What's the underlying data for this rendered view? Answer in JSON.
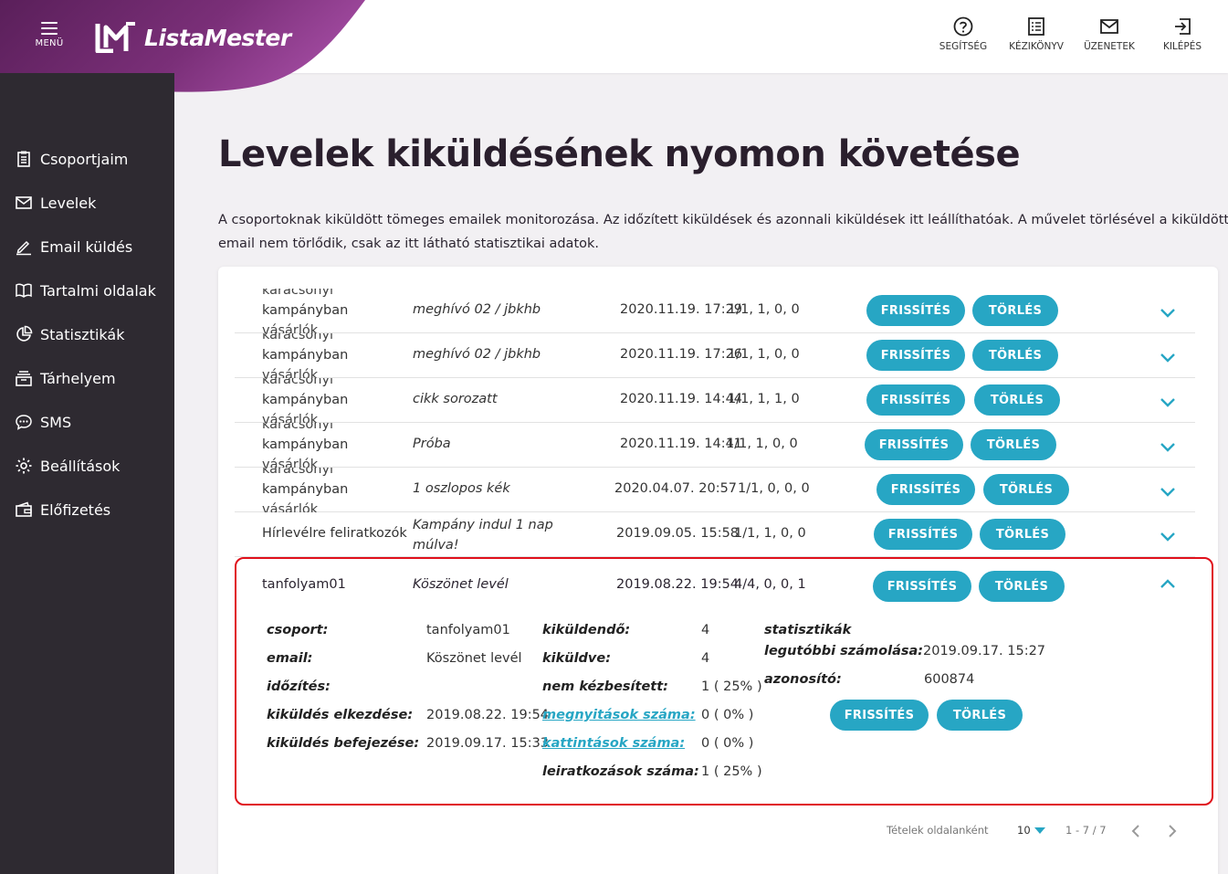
{
  "header": {
    "menu_label": "MENÜ",
    "logo_text": "ListaMester",
    "actions": [
      {
        "label": "SEGÍTSÉG",
        "icon": "help-icon"
      },
      {
        "label": "KÉZIKÖNYV",
        "icon": "manual-icon"
      },
      {
        "label": "ÜZENETEK",
        "icon": "mail-icon"
      },
      {
        "label": "KILÉPÉS",
        "icon": "logout-icon"
      }
    ]
  },
  "sidebar": {
    "items": [
      {
        "label": "Csoportjaim",
        "icon": "clipboard-icon"
      },
      {
        "label": "Levelek",
        "icon": "envelope-icon"
      },
      {
        "label": "Email küldés",
        "icon": "pen-icon"
      },
      {
        "label": "Tartalmi oldalak",
        "icon": "book-icon"
      },
      {
        "label": "Statisztikák",
        "icon": "pie-chart-icon"
      },
      {
        "label": "Tárhelyem",
        "icon": "storage-icon"
      },
      {
        "label": "SMS",
        "icon": "sms-icon"
      },
      {
        "label": "Beállítások",
        "icon": "gear-icon"
      },
      {
        "label": "Előfizetés",
        "icon": "wallet-icon"
      }
    ]
  },
  "page": {
    "title": "Levelek kiküldésének nyomon követése",
    "description": "A csoportoknak kiküldött tömeges emailek monitorozása. Az időzített kiküldések és azonnali kiküldések itt leállíthatóak. A művelet törlésével a kiküldött email nem törlődik, csak az itt látható statisztikai adatok."
  },
  "buttons": {
    "refresh": "FRISSÍTÉS",
    "delete": "TÖRLÉS"
  },
  "rows": [
    {
      "group_top": "karácsonyi",
      "group_mid": "kampányban",
      "group_bot": "vásárlók",
      "email": "meghívó 02 / jbkhb",
      "date": "2020.11.19. 17:29",
      "stats": "1/1, 1, 0, 0"
    },
    {
      "group_top": "karácsonyi",
      "group_mid": "kampányban",
      "group_bot": "vásárlók",
      "email": "meghívó 02 / jbkhb",
      "date": "2020.11.19. 17:26",
      "stats": "1/1, 1, 0, 0"
    },
    {
      "group_top": "karácsonyi",
      "group_mid": "kampányban",
      "group_bot": "vásárlók",
      "email": "cikk sorozatt",
      "date": "2020.11.19. 14:44",
      "stats": "1/1, 1, 1, 0"
    },
    {
      "group_top": "karácsonyi",
      "group_mid": "kampányban",
      "group_bot": "vásárlók",
      "email": "Próba",
      "date": "2020.11.19. 14:41",
      "stats": "1/1, 1, 0, 0"
    },
    {
      "group_top": "karácsonyi",
      "group_mid": "kampányban",
      "group_bot": "vásárlók",
      "email": "1 oszlopos kék",
      "date": "2020.04.07. 20:57",
      "stats": "1/1, 0, 0, 0"
    },
    {
      "group": "Hírlevélre feliratkozók",
      "email": "Kampány indul 1 nap múlva!",
      "date": "2019.09.05. 15:58",
      "stats": "1/1, 1, 0, 0"
    }
  ],
  "expanded": {
    "group": "tanfolyam01",
    "email": "Köszönet levél",
    "date": "2019.08.22. 19:54",
    "stats": "4/4, 0, 0, 1",
    "details": {
      "group_label": "csoport:",
      "group_value": "tanfolyam01",
      "email_label": "email:",
      "email_value": "Köszönet levél",
      "schedule_label": "időzítés:",
      "schedule_value": "",
      "start_label": "kiküldés elkezdése:",
      "start_value": "2019.08.22. 19:54",
      "end_label": "kiküldés befejezése:",
      "end_value": "2019.09.17. 15:33",
      "to_send_label": "kiküldendő:",
      "to_send_value": "4",
      "sent_label": "kiküldve:",
      "sent_value": "4",
      "undelivered_label": "nem kézbesített:",
      "undelivered_value": "1 ( 25% )",
      "opens_label": "megnyitások száma:",
      "opens_value": "0 ( 0% )",
      "clicks_label": "kattintások száma:",
      "clicks_value": "0 ( 0% )",
      "unsubs_label": "leiratkozások száma:",
      "unsubs_value": "1 ( 25% )",
      "stats_title": "statisztikák",
      "last_calc_label": "legutóbbi számolása:",
      "last_calc_value": "2019.09.17. 15:27",
      "id_label": "azonosító:",
      "id_value": "600874"
    }
  },
  "pagination": {
    "per_page_label": "Tételek oldalanként",
    "per_page_value": "10",
    "range": "1 - 7 / 7"
  },
  "colors": {
    "accent": "#27a6c4",
    "sidebar_bg": "#2e2a31",
    "brand_purple": "#8a3a88",
    "highlight_border": "#e0101b"
  }
}
